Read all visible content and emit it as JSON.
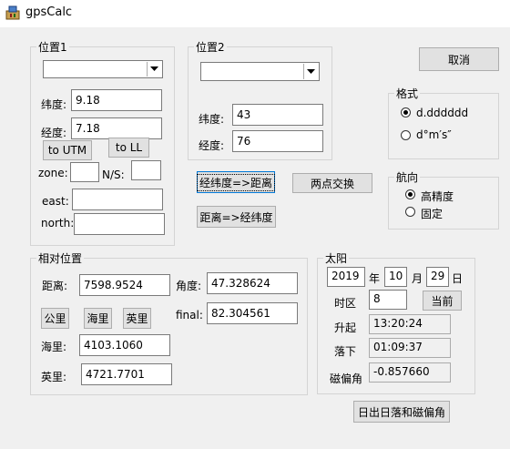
{
  "window": {
    "title": "gpsCalc"
  },
  "pos1": {
    "legend": "位置1",
    "lat_label": "纬度:",
    "lat_value": "9.18",
    "lon_label": "经度:",
    "lon_value": "7.18",
    "to_utm": "to UTM",
    "to_ll": "to LL",
    "zone_label": "zone:",
    "zone_value": "",
    "ns_label": "N/S:",
    "ns_value": "",
    "east_label": "east:",
    "east_value": "",
    "north_label": "north:",
    "north_value": ""
  },
  "pos2": {
    "legend": "位置2",
    "lat_label": "纬度:",
    "lat_value": "43",
    "lon_label": "经度:",
    "lon_value": "76"
  },
  "actions": {
    "cancel": "取消",
    "ll_to_dist": "经纬度=>距离",
    "swap": "两点交换",
    "dist_to_ll": "距离=>经纬度",
    "sun_calc": "日出日落和磁偏角"
  },
  "format": {
    "legend": "格式",
    "options": [
      "d.dddddd",
      "d°m′s″"
    ],
    "selected": 0
  },
  "heading": {
    "legend": "航向",
    "options": [
      "高精度",
      "固定"
    ],
    "selected": 0
  },
  "relative": {
    "legend": "相对位置",
    "dist_label": "距离:",
    "dist_value": "7598.9524",
    "angle_label": "角度:",
    "angle_value": "47.328624",
    "final_label": "final:",
    "final_value": "82.304561",
    "unit_km": "公里",
    "unit_nmi": "海里",
    "unit_mi": "英里",
    "nmi_label": "海里:",
    "nmi_value": "4103.1060",
    "mi_label": "英里:",
    "mi_value": "4721.7701"
  },
  "sun": {
    "legend": "太阳",
    "year": "2019",
    "year_label": "年",
    "month": "10",
    "month_label": "月",
    "day": "29",
    "day_label": "日",
    "tz_label": "时区",
    "tz_value": "8",
    "now_button": "当前",
    "rise_label": "升起",
    "rise_value": "13:20:24",
    "set_label": "落下",
    "set_value": "01:09:37",
    "decl_label": "磁偏角",
    "decl_value": "-0.857660"
  },
  "colors": {
    "accent": "#0078d7",
    "window_bg": "#f0f0f0"
  }
}
